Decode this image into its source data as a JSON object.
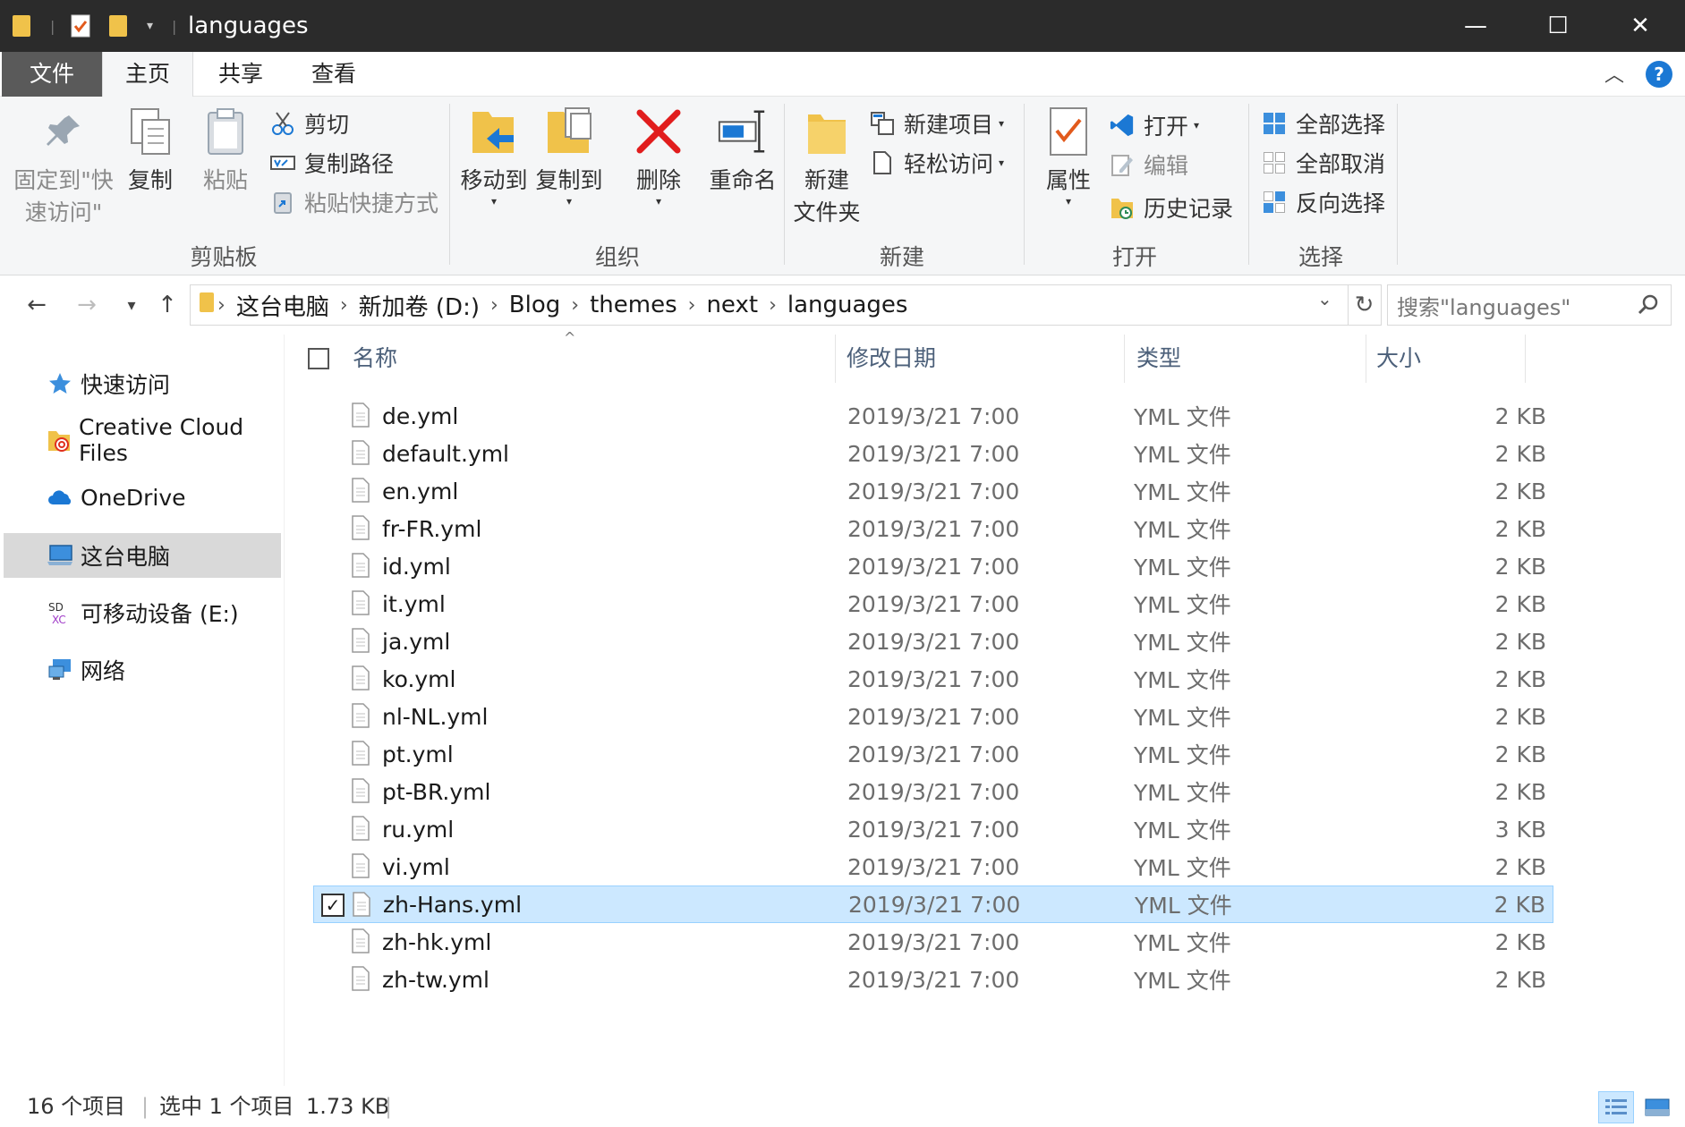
{
  "window": {
    "title": "languages",
    "minimize": "—",
    "maximize": "☐",
    "close": "✕"
  },
  "ribbon_tabs": [
    "文件",
    "主页",
    "共享",
    "查看"
  ],
  "ribbon": {
    "clipboard": {
      "pin_line1": "固定到\"快",
      "pin_line2": "速访问\"",
      "copy": "复制",
      "paste": "粘贴",
      "cut": "剪切",
      "copy_path": "复制路径",
      "paste_shortcut": "粘贴快捷方式",
      "label": "剪贴板"
    },
    "organize": {
      "move_to": "移动到",
      "copy_to": "复制到",
      "delete": "删除",
      "rename": "重命名",
      "label": "组织"
    },
    "new": {
      "new_folder_line1": "新建",
      "new_folder_line2": "文件夹",
      "new_item": "新建项目",
      "easy_access": "轻松访问",
      "label": "新建"
    },
    "open": {
      "properties": "属性",
      "open": "打开",
      "edit": "编辑",
      "history": "历史记录",
      "label": "打开"
    },
    "select": {
      "select_all": "全部选择",
      "select_none": "全部取消",
      "invert": "反向选择",
      "label": "选择"
    }
  },
  "address": {
    "crumbs": [
      "这台电脑",
      "新加卷 (D:)",
      "Blog",
      "themes",
      "next",
      "languages"
    ],
    "search_placeholder": "搜索\"languages\""
  },
  "nav_pane": [
    {
      "label": "快速访问",
      "icon": "star-icon"
    },
    {
      "label": "Creative Cloud Files",
      "icon": "creative-cloud-icon"
    },
    {
      "label": "OneDrive",
      "icon": "cloud-icon"
    },
    {
      "label": "这台电脑",
      "icon": "computer-icon",
      "selected": true
    },
    {
      "label": "可移动设备 (E:)",
      "icon": "sd-card-icon"
    },
    {
      "label": "网络",
      "icon": "network-icon"
    }
  ],
  "columns": {
    "name": "名称",
    "date": "修改日期",
    "type": "类型",
    "size": "大小"
  },
  "files": [
    {
      "name": "de.yml",
      "date": "2019/3/21 7:00",
      "type": "YML 文件",
      "size": "2 KB"
    },
    {
      "name": "default.yml",
      "date": "2019/3/21 7:00",
      "type": "YML 文件",
      "size": "2 KB"
    },
    {
      "name": "en.yml",
      "date": "2019/3/21 7:00",
      "type": "YML 文件",
      "size": "2 KB"
    },
    {
      "name": "fr-FR.yml",
      "date": "2019/3/21 7:00",
      "type": "YML 文件",
      "size": "2 KB"
    },
    {
      "name": "id.yml",
      "date": "2019/3/21 7:00",
      "type": "YML 文件",
      "size": "2 KB"
    },
    {
      "name": "it.yml",
      "date": "2019/3/21 7:00",
      "type": "YML 文件",
      "size": "2 KB"
    },
    {
      "name": "ja.yml",
      "date": "2019/3/21 7:00",
      "type": "YML 文件",
      "size": "2 KB"
    },
    {
      "name": "ko.yml",
      "date": "2019/3/21 7:00",
      "type": "YML 文件",
      "size": "2 KB"
    },
    {
      "name": "nl-NL.yml",
      "date": "2019/3/21 7:00",
      "type": "YML 文件",
      "size": "2 KB"
    },
    {
      "name": "pt.yml",
      "date": "2019/3/21 7:00",
      "type": "YML 文件",
      "size": "2 KB"
    },
    {
      "name": "pt-BR.yml",
      "date": "2019/3/21 7:00",
      "type": "YML 文件",
      "size": "2 KB"
    },
    {
      "name": "ru.yml",
      "date": "2019/3/21 7:00",
      "type": "YML 文件",
      "size": "3 KB"
    },
    {
      "name": "vi.yml",
      "date": "2019/3/21 7:00",
      "type": "YML 文件",
      "size": "2 KB"
    },
    {
      "name": "zh-Hans.yml",
      "date": "2019/3/21 7:00",
      "type": "YML 文件",
      "size": "2 KB",
      "selected": true
    },
    {
      "name": "zh-hk.yml",
      "date": "2019/3/21 7:00",
      "type": "YML 文件",
      "size": "2 KB"
    },
    {
      "name": "zh-tw.yml",
      "date": "2019/3/21 7:00",
      "type": "YML 文件",
      "size": "2 KB"
    }
  ],
  "status": {
    "item_count": "16 个项目",
    "selection": "选中 1 个项目",
    "selection_size": "1.73 KB"
  },
  "colors": {
    "titlebar": "#2b2b2b",
    "selection": "#cce8ff",
    "selection_border": "#99d1ff",
    "accent": "#1b78d4"
  }
}
